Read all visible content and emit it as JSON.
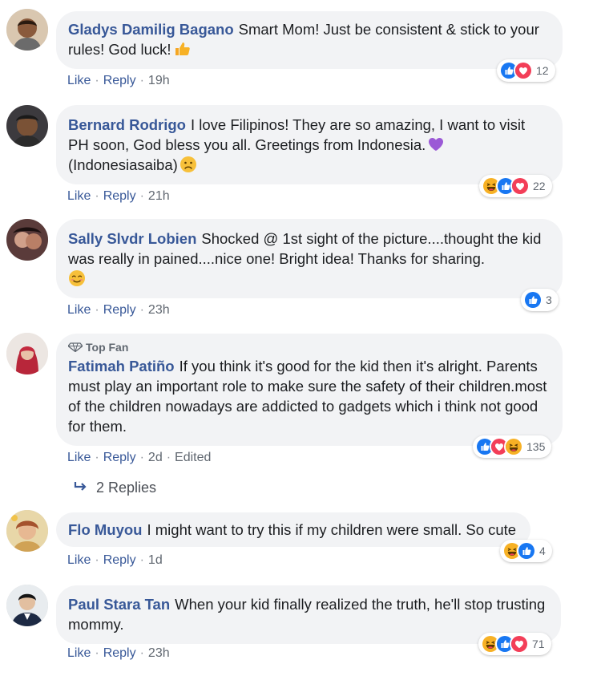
{
  "comments": [
    {
      "author": "Gladys Damilig Bagano",
      "text": "Smart Mom! Just be consistent & stick to your rules! God luck!",
      "like": "Like",
      "reply": "Reply",
      "time": "19h",
      "reaction_count": "12",
      "reactions": [
        "like-icon",
        "love-icon"
      ]
    },
    {
      "author": "Bernard Rodrigo",
      "text": "I love Filipinos! They are so amazing, I want to visit PH soon, God bless you all. Greetings from Indonesia.",
      "text2": "(Indonesiasaiba)",
      "like": "Like",
      "reply": "Reply",
      "time": "21h",
      "reaction_count": "22",
      "reactions": [
        "haha-icon",
        "like-icon",
        "love-icon"
      ]
    },
    {
      "author": "Sally Slvdr Lobien",
      "text": "Shocked @ 1st sight of the picture....thought the kid was really in pained....nice one! Bright idea! Thanks for sharing.",
      "like": "Like",
      "reply": "Reply",
      "time": "23h",
      "reaction_count": "3",
      "reactions": [
        "like-icon"
      ]
    },
    {
      "badge": "Top Fan",
      "author": "Fatimah Patiño",
      "text": "If you think it's good for the kid then it's alright. Parents must play an important role to make sure the safety of their children.most of the children nowadays are addicted to gadgets which i think not good for them.",
      "like": "Like",
      "reply": "Reply",
      "time": "2d",
      "edited": "Edited",
      "reaction_count": "135",
      "reactions": [
        "like-icon",
        "love-icon",
        "haha-icon"
      ]
    },
    {
      "author": "Flo Muyou",
      "text": "I might want to try this if my children were small. So cute",
      "like": "Like",
      "reply": "Reply",
      "time": "1d",
      "reaction_count": "4",
      "reactions": [
        "haha-icon",
        "like-icon"
      ]
    },
    {
      "author": "Paul Stara Tan",
      "text": "When your kid finally realized the truth, he'll stop trusting mommy.",
      "like": "Like",
      "reply": "Reply",
      "time": "23h",
      "reaction_count": "71",
      "reactions": [
        "haha-icon",
        "like-icon",
        "love-icon"
      ]
    }
  ],
  "replies_link": "2 Replies",
  "colors": {
    "author": "#385898",
    "like_blue": "#1877f2",
    "love_red": "#f33e58",
    "haha_yellow": "#f7b125",
    "bubble": "#f2f3f5"
  }
}
